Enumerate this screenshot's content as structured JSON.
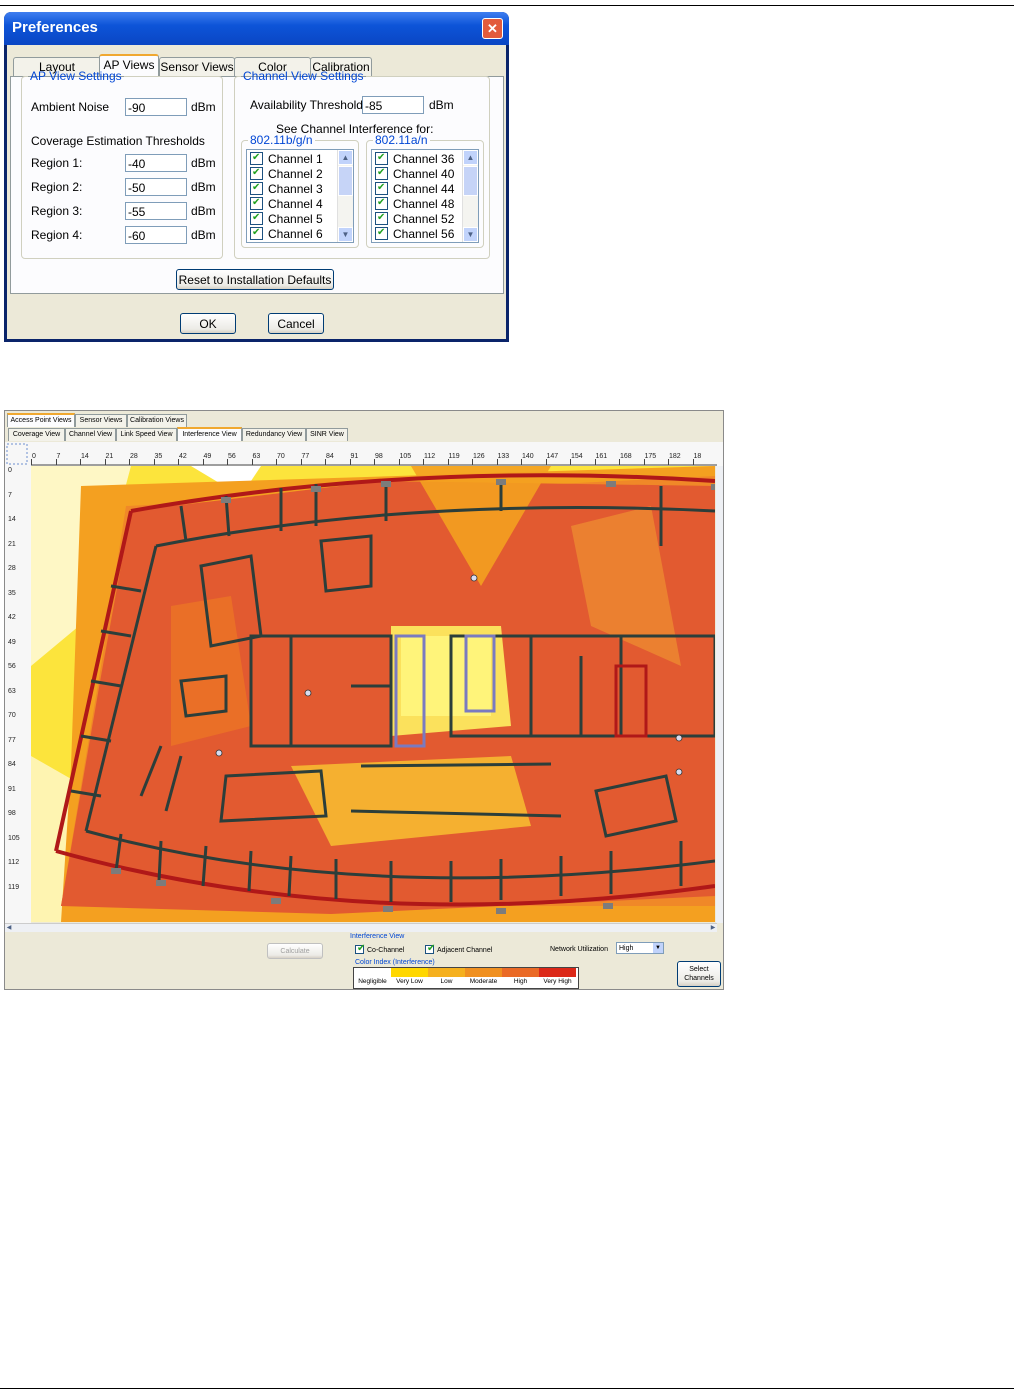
{
  "dialog": {
    "title": "Preferences",
    "close_glyph": "✕",
    "tabs": [
      "Layout Designer",
      "AP Views",
      "Sensor Views",
      "Color Palettes",
      "Calibration"
    ],
    "active_tab": "AP Views",
    "ap_view": {
      "legend": "AP View Settings",
      "ambient_noise_label": "Ambient Noise",
      "ambient_noise_value": "-90",
      "unit": "dBm",
      "thresholds_label": "Coverage Estimation Thresholds",
      "regions": [
        {
          "label": "Region 1:",
          "value": "-40"
        },
        {
          "label": "Region 2:",
          "value": "-50"
        },
        {
          "label": "Region 3:",
          "value": "-55"
        },
        {
          "label": "Region 4:",
          "value": "-60"
        }
      ]
    },
    "channel_view": {
      "legend": "Channel View Settings",
      "availability_label": "Availability Threshold:",
      "availability_value": "-85",
      "unit": "dBm",
      "interference_label": "See Channel Interference for:",
      "band_bgn": {
        "legend": "802.11b/g/n",
        "channels": [
          "Channel 1",
          "Channel 2",
          "Channel 3",
          "Channel 4",
          "Channel 5",
          "Channel 6"
        ]
      },
      "band_an": {
        "legend": "802.11a/n",
        "channels": [
          "Channel 36",
          "Channel 40",
          "Channel 44",
          "Channel 48",
          "Channel 52",
          "Channel 56"
        ]
      }
    },
    "reset_button": "Reset to Installation Defaults",
    "ok_button": "OK",
    "cancel_button": "Cancel"
  },
  "app": {
    "top_tabs": [
      "Access Point Views",
      "Sensor Views",
      "Calibration Views"
    ],
    "view_tabs": [
      "Coverage View",
      "Channel View",
      "Link Speed View",
      "Interference View",
      "Redundancy View",
      "SINR View"
    ],
    "active_view_tab": "Interference View",
    "ruler_x": [
      "0",
      "7",
      "14",
      "21",
      "28",
      "35",
      "42",
      "49",
      "56",
      "63",
      "70",
      "77",
      "84",
      "91",
      "98",
      "105",
      "112",
      "119",
      "126",
      "133",
      "140",
      "147",
      "154",
      "161",
      "168",
      "175",
      "182",
      "18"
    ],
    "ruler_y": [
      "0",
      "7",
      "14",
      "21",
      "28",
      "35",
      "42",
      "49",
      "56",
      "63",
      "70",
      "77",
      "84",
      "91",
      "98",
      "105",
      "112",
      "119"
    ],
    "calculate_button": "Calculate",
    "interference_view_legend": "Interference View",
    "co_channel_label": "Co-Channel",
    "adjacent_channel_label": "Adjacent Channel",
    "network_utilization_label": "Network Utilization",
    "network_utilization_value": "High",
    "color_index_label": "Color Index (Interference)",
    "color_index": [
      {
        "label": "Negligible",
        "color": "#ffffff"
      },
      {
        "label": "Very Low",
        "color": "#ffd700"
      },
      {
        "label": "Low",
        "color": "#f5b01e"
      },
      {
        "label": "Moderate",
        "color": "#f09020"
      },
      {
        "label": "High",
        "color": "#ea6a26"
      },
      {
        "label": "Very High",
        "color": "#dc2818"
      }
    ],
    "select_channels_button_line1": "Select",
    "select_channels_button_line2": "Channels"
  }
}
